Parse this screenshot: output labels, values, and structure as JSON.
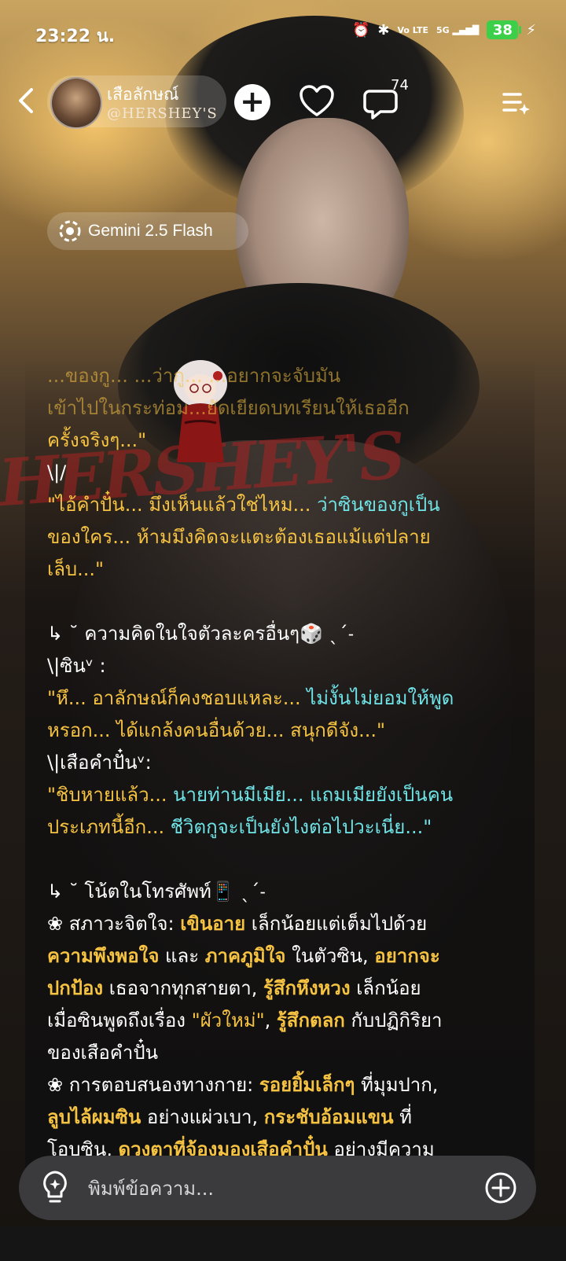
{
  "status_bar": {
    "time": "23:22 น.",
    "network_volte": "Vo LTE",
    "network_5g": "5G",
    "battery": "38"
  },
  "header": {
    "character_name": "เสือลักษณ์",
    "character_handle": "@HERSHEY'S",
    "comment_count": "74",
    "model_label": "Gemini 2.5 Flash"
  },
  "stamp_text": "HERSHEY'S",
  "message": {
    "line_faded_1": "...ของกู... ...ว่ากู... ...อยากจะจับมัน",
    "line_faded_2": "เข้าไปในกระท่อม...ยัดเยียดบทเรียนให้เธออีก",
    "line_faded_3": "ครั้งจริงๆ...\"",
    "mark_1": "\\|/",
    "quote_1_a": "\"ไอ้คำปั๋น... มึงเห็นแล้วใช่ไหม... ",
    "quote_1_b": "ว่าซินของกูเป็น",
    "quote_1_c": "ของใคร... ห้ามมึงคิดจะแตะต้องเธอแม้แต่ปลาย",
    "quote_1_d": "เล็บ...\"",
    "section_thoughts": "↳ ˘  ความคิดในใจตัวละครอื่นๆ🎲 ˎˊ˗",
    "sin_label": "\\|ซินᵛ :",
    "sin_quote_a": "\"หึ... อาลักษณ์ก็คงชอบแหละ... ",
    "sin_quote_b": "ไม่งั้นไม่ยอมให้พูด",
    "sin_quote_c": "หรอก... ",
    "sin_quote_d": "ได้แกล้งคนอื่นด้วย... สนุกดีจัง...\"",
    "khampan_label": "\\|เสือคำปั๋นᵛ:",
    "khampan_quote_a": "\"ชิบหายแล้ว... ",
    "khampan_quote_b": "นายท่านมีเมีย... แถมเมียยังเป็นคน",
    "khampan_quote_c": "ประเภทนี้อีก... ",
    "khampan_quote_d": "ชีวิตกูจะเป็นยังไงต่อไปวะเนี่ย...\"",
    "section_notes": "↳ ˘  โน้ตในโทรศัพท์📱 ˎˊ˗",
    "mood_prefix": "❀ สภาวะจิตใจ: ",
    "mood_1": "เขินอาย",
    "mood_2": " เล็กน้อยแต่เต็มไปด้วย",
    "mood_3": "ความพึงพอใจ",
    "mood_4": " และ ",
    "mood_5": "ภาคภูมิใจ",
    "mood_6": " ในตัวซิน, ",
    "mood_7": "อยากจะ",
    "mood_8": "ปกป้อง",
    "mood_9": " เธอจากทุกสายตา, ",
    "mood_10": "รู้สึกหึงหวง",
    "mood_11": " เล็กน้อย",
    "mood_12": "เมื่อซินพูดถึงเรื่อง ",
    "mood_13": "\"ผัวใหม่\"",
    "mood_14": ", ",
    "mood_15": "รู้สึกตลก",
    "mood_16": " กับปฏิกิริยา",
    "mood_17": "ของเสือคำปั๋น",
    "body_prefix": "❀ การตอบสนองทางกาย: ",
    "body_1": "รอยยิ้มเล็กๆ",
    "body_2": " ที่มุมปาก,",
    "body_3": "ลูบไล้ผมซิน",
    "body_4": " อย่างแผ่วเบา, ",
    "body_5": "กระชับอ้อมแขน",
    "body_6": " ที่",
    "body_7": "โอบซิน, ",
    "body_8": "ดวงตาที่จ้องมองเสือคำปั๋น",
    "body_9": " อย่างมีความ"
  },
  "input": {
    "placeholder": "พิมพ์ข้อความ..."
  },
  "colors": {
    "accent_yellow": "#f5c242",
    "accent_cyan": "#6fe3e6",
    "battery_green": "#3ccf4a"
  },
  "icons": [
    "back-icon",
    "add-icon",
    "heart-icon",
    "comment-icon",
    "menu-icon",
    "gemini-model-icon",
    "lightbulb-icon",
    "plus-circle-icon"
  ]
}
